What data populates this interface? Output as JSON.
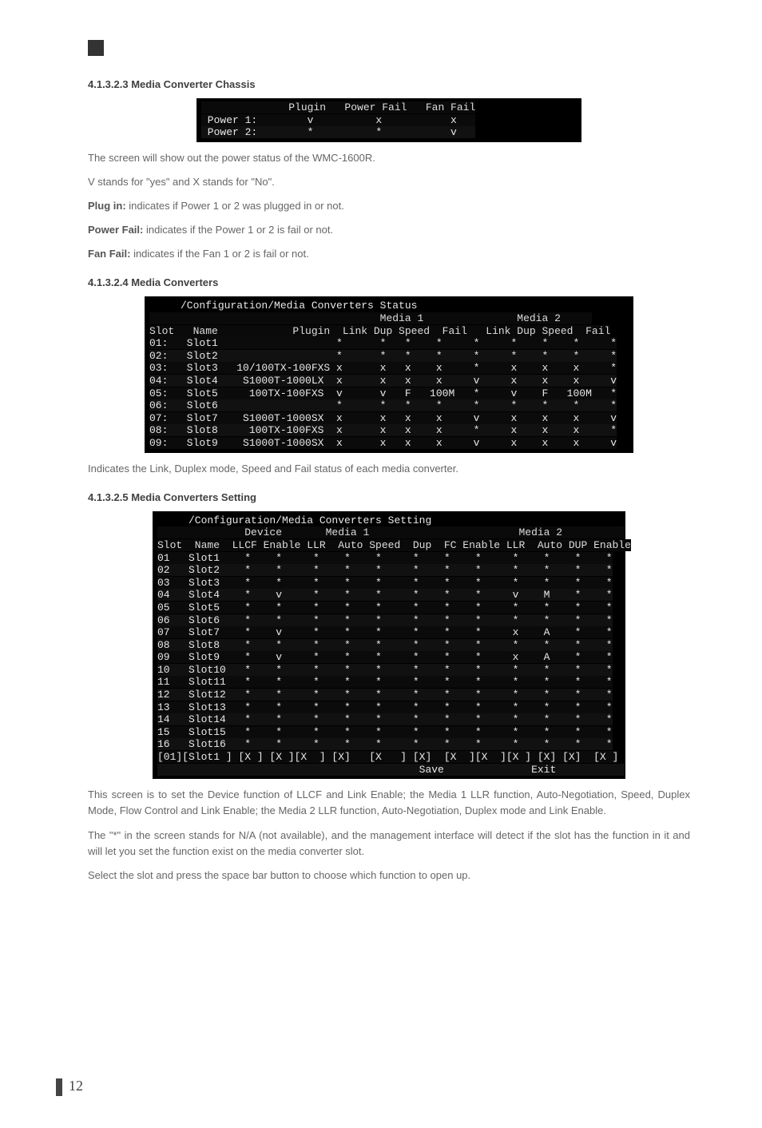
{
  "headings": {
    "h4_1_3_2_3": "4.1.3.2.3 Media Converter Chassis",
    "h4_1_3_2_4": "4.1.3.2.4 Media Converters",
    "h4_1_3_2_5": "4.1.3.2.5 Media Converters Setting"
  },
  "text": {
    "p1": "The screen will show out the power status of the WMC-1600R.",
    "p2": "V stands for \"yes\" and X stands for \"No\".",
    "p3_label": "Plug in:",
    "p3_rest": " indicates if Power 1 or 2 was plugged in or not.",
    "p4_label": "Power Fail:",
    "p4_rest": " indicates if the Power 1 or 2 is fail or not.",
    "p5_label": "Fan Fail:",
    "p5_rest": " indicates if the Fan 1 or 2 is fail or not.",
    "p6": "Indicates the Link, Duplex mode, Speed and Fail status of each media converter.",
    "p7": "This screen is to set the Device function of LLCF and Link Enable; the Media 1 LLR function, Auto-Negotiation, Speed, Duplex Mode, Flow Control and Link Enable; the Media 2 LLR function, Auto-Negotiation, Duplex mode and Link Enable.",
    "p8": "The \"*\" in the screen stands for N/A (not available), and the management interface will detect if the slot has the function in it and will let you set the function exist on the media converter slot.",
    "p9": "Select the slot and press the space bar button to choose which function to open up."
  },
  "terminal_power": {
    "header": "              Plugin   Power Fail   Fan Fail",
    "row1": " Power 1:        v          x           x   ",
    "row2": " Power 2:        *          *           v   "
  },
  "terminal_status": {
    "title": "     /Configuration/Media Converters Status",
    "hdr1": "                                     Media 1               Media 2     ",
    "hdr2": "Slot   Name            Plugin  Link Dup Speed  Fail   Link Dup Speed  Fail",
    "rows": [
      "01:   Slot1                   *      *   *    *     *     *    *    *     *",
      "02:   Slot2                   *      *   *    *     *     *    *    *     *",
      "03:   Slot3   10/100TX-100FXS x      x   x    x     *     x    x    x     *",
      "04:   Slot4    S1000T-1000LX  x      x   x    x     v     x    x    x     v",
      "05:   Slot5     100TX-100FXS  v      v   F   100M   *     v    F   100M   *",
      "06:   Slot6                   *      *   *    *     *     *    *    *     *",
      "07:   Slot7    S1000T-1000SX  x      x   x    x     v     x    x    x     v",
      "08:   Slot8     100TX-100FXS  x      x   x    x     *     x    x    x     *",
      "09:   Slot9    S1000T-1000SX  x      x   x    x     v     x    x    x     v"
    ]
  },
  "terminal_setting": {
    "title": "     /Configuration/Media Converters Setting",
    "hdr1": "              Device       Media 1                        Media 2          ",
    "hdr2": "Slot  Name  LLCF Enable LLR  Auto Speed  Dup  FC Enable LLR  Auto DUP Enable",
    "rows": [
      "01   Slot1    *    *     *    *    *     *    *    *     *    *    *    *",
      "02   Slot2    *    *     *    *    *     *    *    *     *    *    *    *",
      "03   Slot3    *    *     *    *    *     *    *    *     *    *    *    *",
      "04   Slot4    *    v     *    *    *     *    *    *     v    M    *    *",
      "05   Slot5    *    *     *    *    *     *    *    *     *    *    *    *",
      "06   Slot6    *    *     *    *    *     *    *    *     *    *    *    *",
      "07   Slot7    *    v     *    *    *     *    *    *     x    A    *    *",
      "08   Slot8    *    *     *    *    *     *    *    *     *    *    *    *",
      "09   Slot9    *    v     *    *    *     *    *    *     x    A    *    *",
      "10   Slot10   *    *     *    *    *     *    *    *     *    *    *    *",
      "11   Slot11   *    *     *    *    *     *    *    *     *    *    *    *",
      "12   Slot12   *    *     *    *    *     *    *    *     *    *    *    *",
      "13   Slot13   *    *     *    *    *     *    *    *     *    *    *    *",
      "14   Slot14   *    *     *    *    *     *    *    *     *    *    *    *",
      "15   Slot15   *    *     *    *    *     *    *    *     *    *    *    *",
      "16   Slot16   *    *     *    *    *     *    *    *     *    *    *    *"
    ],
    "foot1": "[01][Slot1 ] [X ] [X ][X  ] [X]   [X   ] [X]  [X  ][X  ][X ] [X] [X]  [X ]",
    "foot2": "                                          Save              Exit           "
  },
  "pageNumber": "12"
}
